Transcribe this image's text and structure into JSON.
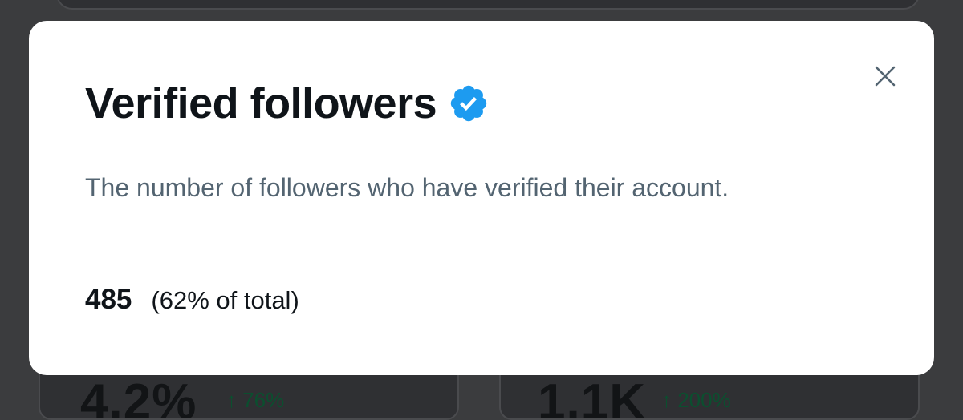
{
  "background": {
    "left_metric": "4.2%",
    "left_change": "↑ 76%",
    "right_metric": "1.1K",
    "right_change": "↑ 200%"
  },
  "modal": {
    "title": "Verified followers",
    "badge_icon": "verified-badge-icon",
    "close_icon": "close-icon",
    "description": "The number of followers who have verified their account.",
    "stat": {
      "value": "485",
      "percent_text": "(62% of total)"
    }
  },
  "colors": {
    "badge": "#1d9bf0",
    "title": "#0f1419",
    "secondary_text": "#536471",
    "background_overlay": "#3b3c3e"
  }
}
